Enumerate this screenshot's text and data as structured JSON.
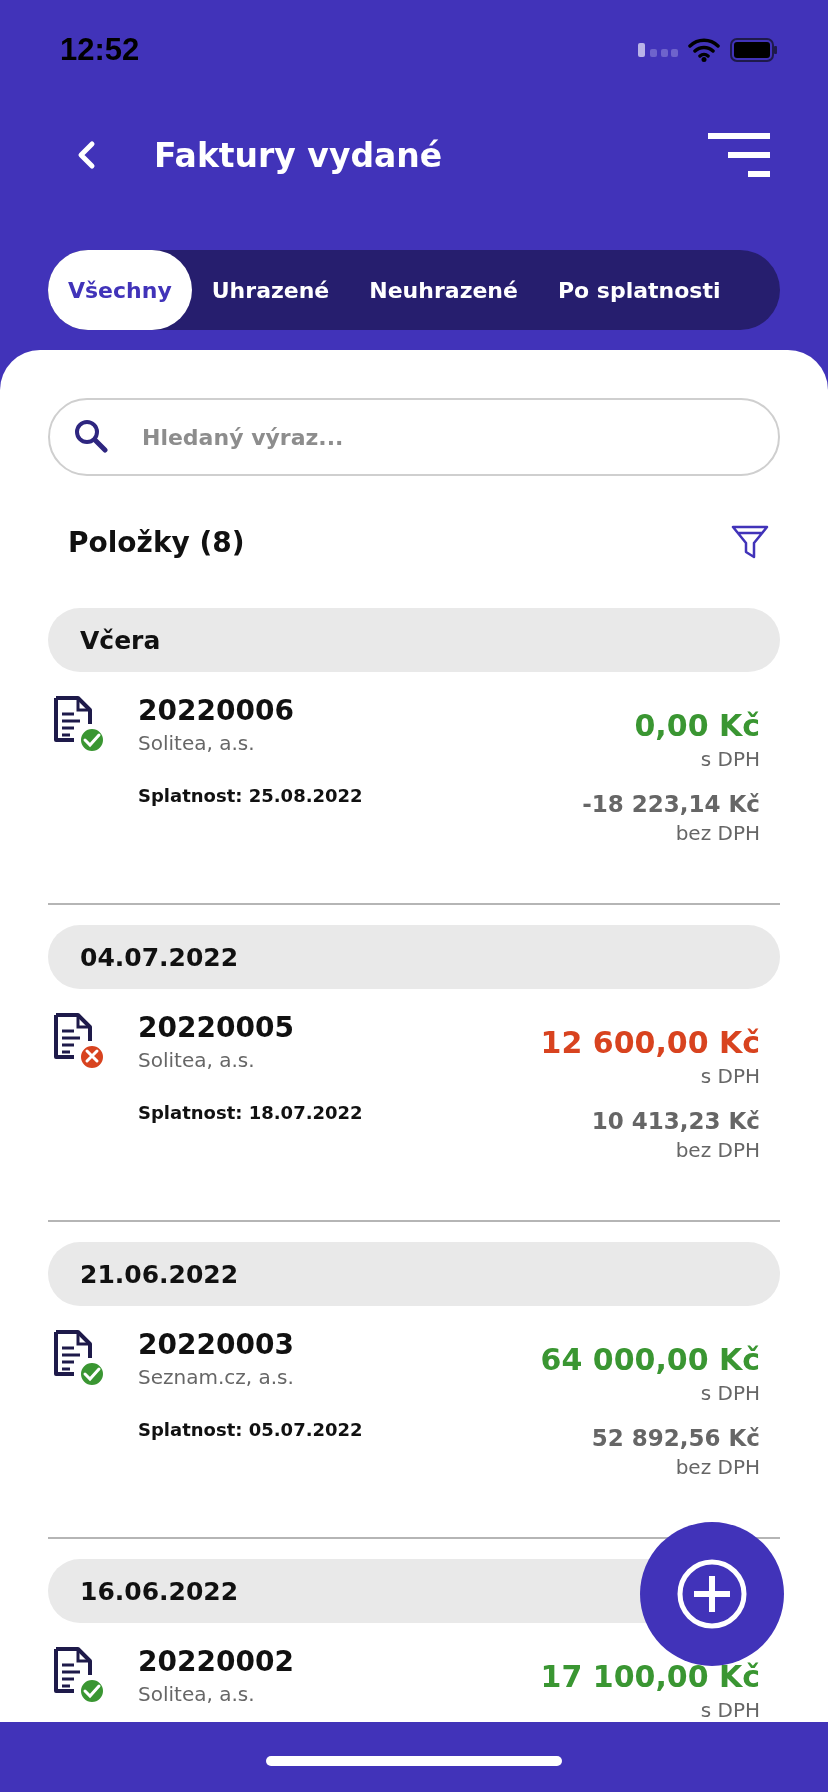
{
  "status_bar": {
    "time": "12:52"
  },
  "header": {
    "title": "Faktury vydané"
  },
  "tabs": [
    {
      "label": "Všechny",
      "selected": true
    },
    {
      "label": "Uhrazené",
      "selected": false
    },
    {
      "label": "Neuhrazené",
      "selected": false
    },
    {
      "label": "Po splatnosti",
      "selected": false
    }
  ],
  "search": {
    "placeholder": "Hledaný výraz..."
  },
  "list_title": "Položky (8)",
  "groups": [
    {
      "date": "Včera",
      "items": [
        {
          "number": "20220006",
          "company": "Solitea, a.s.",
          "paid": true,
          "due": "Splatnost: 25.08.2022",
          "amount": "0,00 Kč",
          "amount_note": "s DPH",
          "net_amount": "-18 223,14 Kč",
          "net_note": "bez DPH"
        }
      ]
    },
    {
      "date": "04.07.2022",
      "items": [
        {
          "number": "20220005",
          "company": "Solitea, a.s.",
          "paid": false,
          "due": "Splatnost: 18.07.2022",
          "amount": "12 600,00 Kč",
          "amount_note": "s DPH",
          "net_amount": "10 413,23 Kč",
          "net_note": "bez DPH"
        }
      ]
    },
    {
      "date": "21.06.2022",
      "items": [
        {
          "number": "20220003",
          "company": "Seznam.cz, a.s.",
          "paid": true,
          "due": "Splatnost: 05.07.2022",
          "amount": "64 000,00 Kč",
          "amount_note": "s DPH",
          "net_amount": "52 892,56 Kč",
          "net_note": "bez DPH"
        }
      ]
    },
    {
      "date": "16.06.2022",
      "items": [
        {
          "number": "20220002",
          "company": "Solitea, a.s.",
          "paid": true,
          "amount": "17 100,00 Kč",
          "amount_note": "s DPH"
        }
      ]
    }
  ]
}
